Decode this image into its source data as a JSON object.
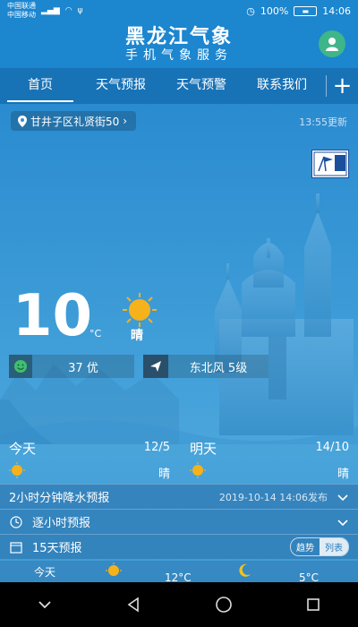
{
  "status_bar": {
    "carrier_1": "中国联通",
    "carrier_2": "中国移动",
    "battery": "100%",
    "time": "14:06"
  },
  "header": {
    "title": "黑龙江气象",
    "subtitle": "手机气象服务"
  },
  "nav": {
    "tabs": [
      {
        "label": "首页"
      },
      {
        "label": "天气预报"
      },
      {
        "label": "天气预警"
      },
      {
        "label": "联系我们"
      }
    ],
    "add_label": "+"
  },
  "location": {
    "name": "甘井子区礼贤街50",
    "updated": "13:55更新"
  },
  "alert": {
    "level_text": "大风",
    "color": "#1a4f9c"
  },
  "current": {
    "temperature": "10",
    "unit": "°C",
    "condition": "晴",
    "aqi": "37 优",
    "wind": "东北风 5级"
  },
  "forecast": {
    "today": {
      "label": "今天",
      "temp": "12/5",
      "condition": "晴"
    },
    "tomorrow": {
      "label": "明天",
      "temp": "14/10",
      "condition": "晴"
    }
  },
  "panels": {
    "precip": {
      "label": "2小时分钟降水预报",
      "meta": "2019-10-14 14:06发布"
    },
    "hourly": {
      "label": "逐小时预报"
    },
    "days15": {
      "label": "15天预报",
      "toggle_trend": "趋势",
      "toggle_list": "列表"
    }
  },
  "bottom_strip": {
    "day_label": "今天",
    "high": "12°C",
    "low": "5°C"
  },
  "colors": {
    "accent": "#1c86cf",
    "sun": "#f5b21b",
    "avatar": "#3fb58a"
  }
}
